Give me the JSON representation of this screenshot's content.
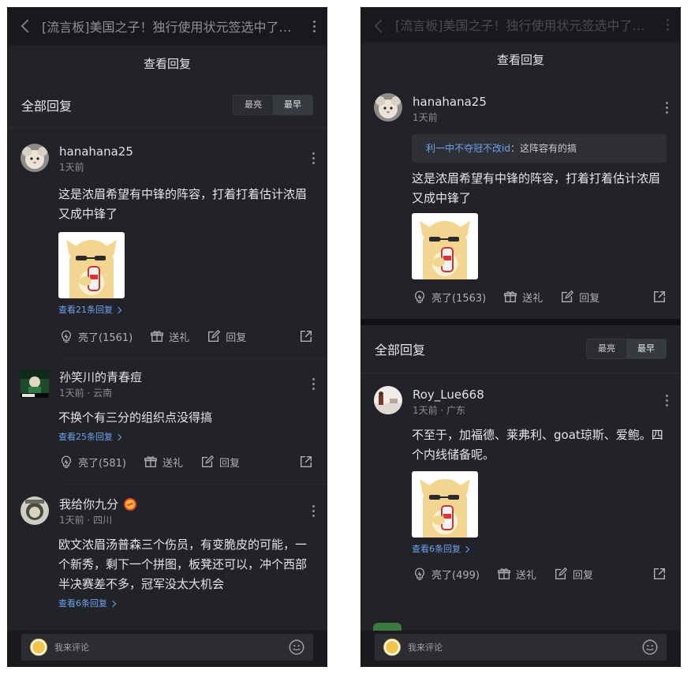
{
  "window": {
    "title": "[流言板]美国之子！独行使用状元签选中了…"
  },
  "sheet": {
    "title": "查看回复"
  },
  "section": {
    "label": "全部回复",
    "sort_options": [
      "最亮",
      "最早"
    ],
    "sort_active": "最早"
  },
  "comment_input": {
    "placeholder": "我来评论"
  },
  "actions": {
    "gift": "送礼",
    "reply": "回复"
  },
  "left": {
    "comments": [
      {
        "user": "hanahana25",
        "meta": "1天前",
        "text": "这是浓眉希望有中锋的阵容，打着打着估计浓眉又成中锋了",
        "has_sticker": true,
        "replies": "查看21条回复",
        "likes": "亮了(1561)"
      },
      {
        "user": "孙笑川的青春痘",
        "meta": "1天前 · 云南",
        "text": "不换个有三分的组织点没得搞",
        "has_sticker": false,
        "replies": "查看25条回复",
        "likes": "亮了(581)"
      },
      {
        "user": "我给你九分",
        "meta": "1天前 · 四川",
        "text": "欧文浓眉汤普森三个伤员，有变脆皮的可能，一个新秀，剩下一个拼图，板凳还可以，冲个西部半决赛差不多，冠军没太大机会",
        "has_sticker": false,
        "replies": "查看6条回复",
        "likes": ""
      }
    ]
  },
  "right": {
    "main": {
      "user": "hanahana25",
      "meta": "1天前",
      "quote_user": "利一中不夺冠不改id",
      "quote_sep": "：",
      "quote_text": "这阵容有的搞",
      "text": "这是浓眉希望有中锋的阵容，打着打着估计浓眉又成中锋了",
      "likes": "亮了(1563)"
    },
    "comments": [
      {
        "user": "Roy_Lue668",
        "meta": "1天前 · 广东",
        "text": "不至于，加福德、莱弗利、goat琼斯、爱鲍。四个内线储备呢。",
        "replies": "查看6条回复",
        "likes": "亮了(499)"
      }
    ]
  },
  "colors": {
    "link": "#6ea2ee",
    "background": "#222328",
    "text": "#e4e5e8",
    "muted": "#8b8d92"
  },
  "icons": [
    "chevron-left-icon",
    "more-vertical-icon",
    "bulb-like-icon",
    "gift-icon",
    "reply-edit-icon",
    "share-icon",
    "smile-icon"
  ]
}
